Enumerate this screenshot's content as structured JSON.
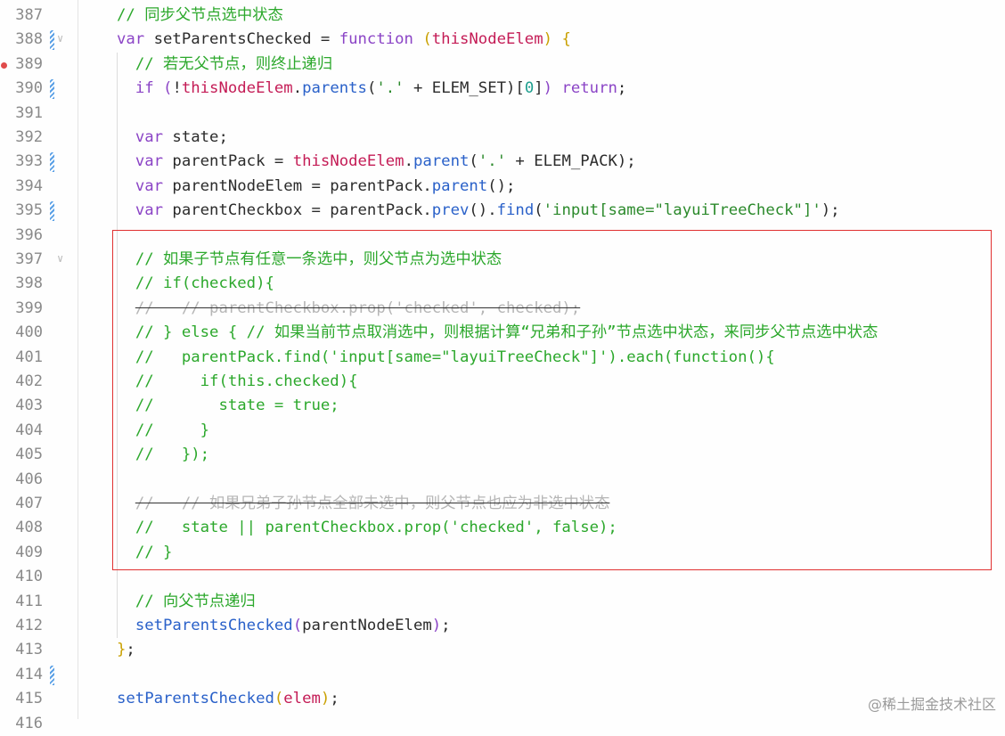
{
  "editor": {
    "lines": [
      {
        "num": "387",
        "tokens": [
          {
            "t": "// 同步父节点选中状态",
            "c": "c"
          }
        ]
      },
      {
        "num": "388",
        "tokens": [
          {
            "t": "var ",
            "c": "k"
          },
          {
            "t": "setParentsChecked = "
          },
          {
            "t": "function",
            "c": "k"
          },
          {
            "t": " "
          },
          {
            "t": "(",
            "c": "p"
          },
          {
            "t": "thisNodeElem",
            "c": "v"
          },
          {
            "t": ")",
            "c": "p"
          },
          {
            "t": " "
          },
          {
            "t": "{",
            "c": "p"
          }
        ]
      },
      {
        "num": "389",
        "tokens": [
          {
            "t": "  "
          },
          {
            "t": "// 若无父节点，则终止递归",
            "c": "c"
          }
        ]
      },
      {
        "num": "390",
        "tokens": [
          {
            "t": "  "
          },
          {
            "t": "if",
            "c": "k"
          },
          {
            "t": " "
          },
          {
            "t": "(",
            "c": "k"
          },
          {
            "t": "!"
          },
          {
            "t": "thisNodeElem",
            "c": "v"
          },
          {
            "t": "."
          },
          {
            "t": "parents",
            "c": "f"
          },
          {
            "t": "("
          },
          {
            "t": "'.'",
            "c": "s"
          },
          {
            "t": " + ELEM_SET)["
          },
          {
            "t": "0",
            "c": "n"
          },
          {
            "t": "]"
          },
          {
            "t": ")",
            "c": "k"
          },
          {
            "t": " "
          },
          {
            "t": "return",
            "c": "k"
          },
          {
            "t": ";"
          }
        ]
      },
      {
        "num": "391",
        "tokens": []
      },
      {
        "num": "392",
        "tokens": [
          {
            "t": "  "
          },
          {
            "t": "var",
            "c": "k"
          },
          {
            "t": " state;"
          }
        ]
      },
      {
        "num": "393",
        "tokens": [
          {
            "t": "  "
          },
          {
            "t": "var",
            "c": "k"
          },
          {
            "t": " parentPack = "
          },
          {
            "t": "thisNodeElem",
            "c": "v"
          },
          {
            "t": "."
          },
          {
            "t": "parent",
            "c": "f"
          },
          {
            "t": "("
          },
          {
            "t": "'.'",
            "c": "s"
          },
          {
            "t": " + ELEM_PACK);"
          }
        ]
      },
      {
        "num": "394",
        "tokens": [
          {
            "t": "  "
          },
          {
            "t": "var",
            "c": "k"
          },
          {
            "t": " parentNodeElem = parentPack."
          },
          {
            "t": "parent",
            "c": "f"
          },
          {
            "t": "();"
          }
        ]
      },
      {
        "num": "395",
        "tokens": [
          {
            "t": "  "
          },
          {
            "t": "var",
            "c": "k"
          },
          {
            "t": " parentCheckbox = parentPack."
          },
          {
            "t": "prev",
            "c": "f"
          },
          {
            "t": "()."
          },
          {
            "t": "find",
            "c": "f"
          },
          {
            "t": "("
          },
          {
            "t": "'input[same=\"layuiTreeCheck\"]'",
            "c": "s"
          },
          {
            "t": ");"
          }
        ]
      },
      {
        "num": "396",
        "tokens": []
      },
      {
        "num": "397",
        "tokens": [
          {
            "t": "  "
          },
          {
            "t": "// 如果子节点有任意一条选中，则父节点为选中状态",
            "c": "c"
          }
        ]
      },
      {
        "num": "398",
        "tokens": [
          {
            "t": "  "
          },
          {
            "t": "// if(checked){",
            "c": "c"
          }
        ]
      },
      {
        "num": "399",
        "tokens": [
          {
            "t": "  "
          },
          {
            "t": "//   // parentCheckbox.prop('checked', checked);",
            "c": "x"
          }
        ]
      },
      {
        "num": "400",
        "tokens": [
          {
            "t": "  "
          },
          {
            "t": "// } else { // 如果当前节点取消选中，则根据计算“兄弟和子孙”节点选中状态，来同步父节点选中状态",
            "c": "c"
          }
        ]
      },
      {
        "num": "401",
        "tokens": [
          {
            "t": "  "
          },
          {
            "t": "//   parentPack.find('input[same=\"layuiTreeCheck\"]').each(function(){",
            "c": "c"
          }
        ]
      },
      {
        "num": "402",
        "tokens": [
          {
            "t": "  "
          },
          {
            "t": "//     if(this.checked){",
            "c": "c"
          }
        ]
      },
      {
        "num": "403",
        "tokens": [
          {
            "t": "  "
          },
          {
            "t": "//       state = true;",
            "c": "c"
          }
        ]
      },
      {
        "num": "404",
        "tokens": [
          {
            "t": "  "
          },
          {
            "t": "//     }",
            "c": "c"
          }
        ]
      },
      {
        "num": "405",
        "tokens": [
          {
            "t": "  "
          },
          {
            "t": "//   });",
            "c": "c"
          }
        ]
      },
      {
        "num": "406",
        "tokens": []
      },
      {
        "num": "407",
        "tokens": [
          {
            "t": "  "
          },
          {
            "t": "//   // 如果兄弟子孙节点全部未选中，则父节点也应为非选中状态",
            "c": "x"
          }
        ]
      },
      {
        "num": "408",
        "tokens": [
          {
            "t": "  "
          },
          {
            "t": "//   state || parentCheckbox.prop('checked', false);",
            "c": "c"
          }
        ]
      },
      {
        "num": "409",
        "tokens": [
          {
            "t": "  "
          },
          {
            "t": "// }",
            "c": "c"
          }
        ]
      },
      {
        "num": "410",
        "tokens": []
      },
      {
        "num": "411",
        "tokens": [
          {
            "t": "  "
          },
          {
            "t": "// 向父节点递归",
            "c": "c"
          }
        ]
      },
      {
        "num": "412",
        "tokens": [
          {
            "t": "  "
          },
          {
            "t": "setParentsChecked",
            "c": "f"
          },
          {
            "t": "(",
            "c": "k"
          },
          {
            "t": "parentNodeElem"
          },
          {
            "t": ")",
            "c": "k"
          },
          {
            "t": ";"
          }
        ]
      },
      {
        "num": "413",
        "tokens": [
          {
            "t": "}",
            "c": "p"
          },
          {
            "t": ";"
          }
        ]
      },
      {
        "num": "414",
        "tokens": []
      },
      {
        "num": "415",
        "tokens": [
          {
            "t": "setParentsChecked",
            "c": "f"
          },
          {
            "t": "(",
            "c": "p"
          },
          {
            "t": "elem",
            "c": "v"
          },
          {
            "t": ")",
            "c": "p"
          },
          {
            "t": ";"
          }
        ]
      },
      {
        "num": "416",
        "tokens": []
      }
    ]
  },
  "watermark": "@稀土掘金技术社区",
  "colors": {
    "comment": "#2ca82c",
    "keyword": "#8b44c6",
    "function": "#2a61c9",
    "string": "#2c8a2c",
    "highlight_border": "#e03030",
    "modified_marker": "#5aa0e6",
    "breakpoint": "#e04b4b"
  }
}
